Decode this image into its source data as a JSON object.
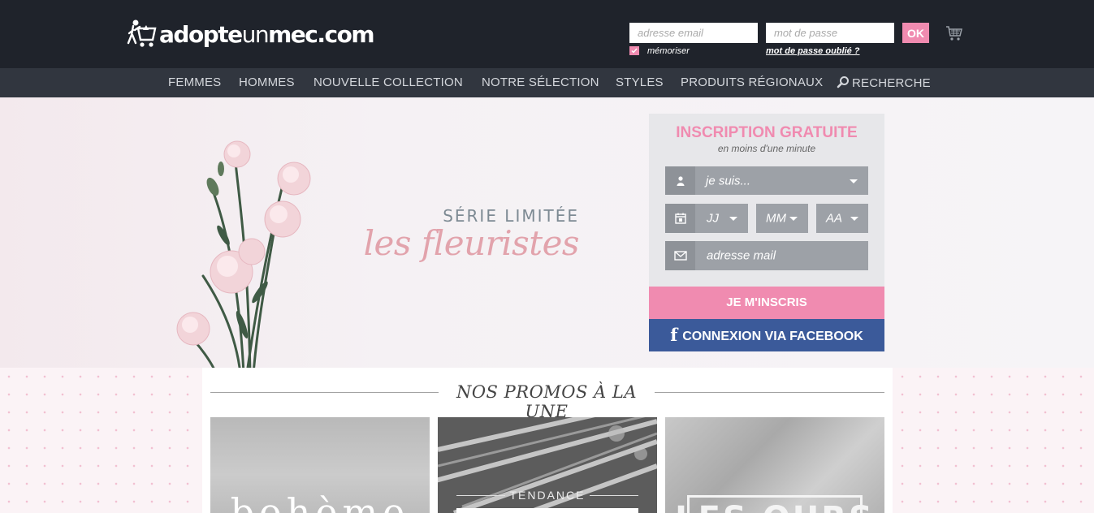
{
  "header": {
    "logo_text_bold1": "adopte",
    "logo_text_thin": "un",
    "logo_text_bold2": "mec.com",
    "email_placeholder": "adresse email",
    "password_placeholder": "mot de passe",
    "ok_label": "OK",
    "remember_label": "mémoriser",
    "forgot_label": "mot de passe oublié ?",
    "icons": {
      "logo": "shopping-cart-man-logo-icon",
      "cart": "shopping-cart-icon",
      "check": "check-icon"
    }
  },
  "nav": {
    "items": [
      {
        "label": "FEMMES"
      },
      {
        "label": "HOMMES"
      },
      {
        "label": "NOUVELLE COLLECTION"
      },
      {
        "label": "NOTRE SÉLECTION"
      },
      {
        "label": "STYLES"
      },
      {
        "label": "PRODUITS RÉGIONAUX"
      },
      {
        "label": "RECHERCHE",
        "icon": "search-icon"
      }
    ]
  },
  "hero": {
    "subtitle": "SÉRIE LIMITÉE",
    "title": "les fleuristes"
  },
  "signup": {
    "title": "INSCRIPTION GRATUITE",
    "subtitle": "en moins d'une minute",
    "gender_value": "je suis...",
    "day_value": "JJ",
    "month_value": "MM",
    "year_value": "AA",
    "email_placeholder": "adresse mail",
    "submit_label": "JE M'INSCRIS",
    "facebook_label": "CONNEXION VIA FACEBOOK",
    "icons": {
      "gender": "user-icon",
      "date": "calendar-icon",
      "email": "envelope-icon",
      "facebook": "facebook-icon"
    }
  },
  "promos": {
    "title": "NOS PROMOS À LA UNE",
    "cards": [
      {
        "text": "bohème"
      },
      {
        "text": "TENDANCE"
      },
      {
        "text": "LES OURS"
      }
    ]
  },
  "colors": {
    "header_bg": "#1f232b",
    "nav_bg": "#31363f",
    "pink": "#f08bb0",
    "facebook": "#3b5a9a",
    "field_gray": "#9da1a7"
  }
}
